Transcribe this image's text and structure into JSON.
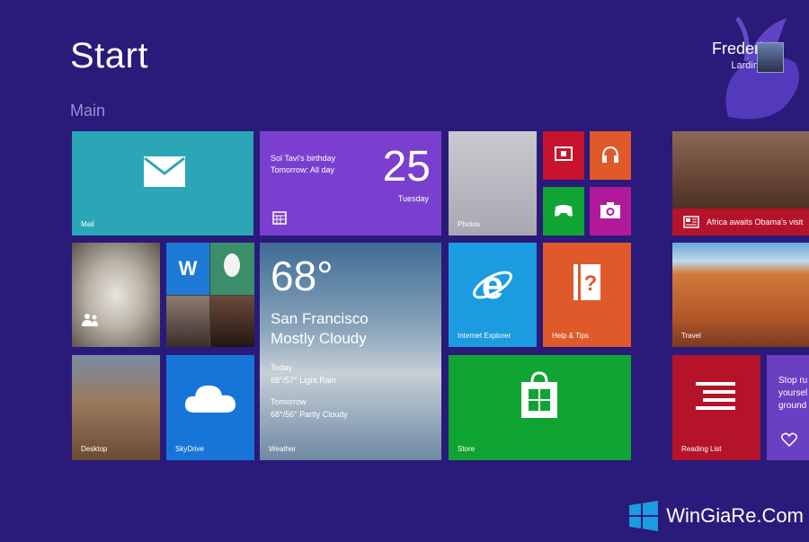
{
  "start": {
    "title": "Start",
    "group": "Main"
  },
  "user": {
    "first": "Frederic",
    "last": "Lardinois"
  },
  "tiles": {
    "mail": "Mail",
    "calendar": {
      "event": "Sol Tavi's birthday",
      "when": "Tomorrow: All day",
      "day_num": "25",
      "weekday": "Tuesday"
    },
    "photos": "Photos",
    "weather": {
      "temp": "68°",
      "city": "San Francisco",
      "condition": "Mostly Cloudy",
      "today_label": "Today",
      "today": "68°/57° Light Rain",
      "tomorrow_label": "Tomorrow",
      "tomorrow": "68°/56° Partly Cloudy",
      "label": "Weather"
    },
    "ie": "Internet Explorer",
    "help": "Help & Tips",
    "desktop": "Desktop",
    "skydrive": "SkyDrive",
    "store": "Store",
    "news": "Africa awaits Obama's visit",
    "travel": "Travel",
    "reading": "Reading List",
    "health": "Stop ru yoursel ground"
  },
  "watermark": "WinGiaRe.Com",
  "colors": {
    "background": "#2a1a7a",
    "mail": "#2aa6b6",
    "calendar": "#7b3fd0",
    "ie": "#1b9be0",
    "help": "#e0592a",
    "skydrive": "#1875d8",
    "store": "#10a432",
    "news": "#b4132a",
    "reading": "#b4132a",
    "health": "#6a3fc2"
  }
}
